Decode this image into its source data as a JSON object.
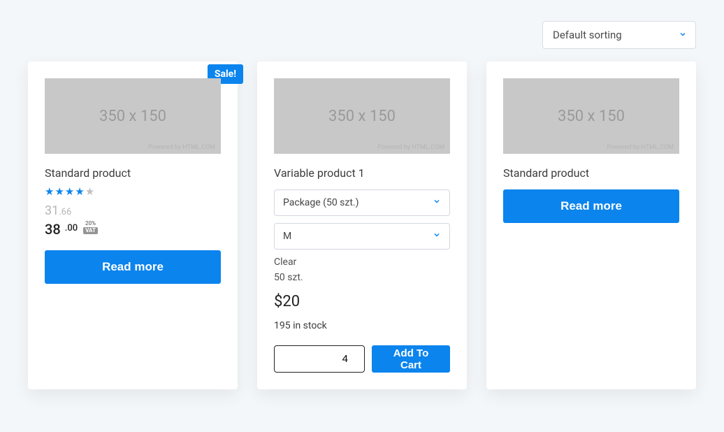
{
  "sort": {
    "selected": "Default sorting"
  },
  "products": [
    {
      "sale_label": "Sale!",
      "placeholder_text": "350 x 150",
      "placeholder_powered": "Powered by HTML.COM",
      "title": "Standard product",
      "rating": 4,
      "old_price_int": "31",
      "old_price_cents": ".66",
      "new_price_int": "38",
      "new_price_cents": ".00",
      "vat_percent": "20%",
      "vat_label": "VAT",
      "button": "Read more"
    },
    {
      "placeholder_text": "350 x 150",
      "placeholder_powered": "Powered by HTML.COM",
      "title": "Variable product 1",
      "option1": "Package (50 szt.)",
      "option2": "M",
      "clear_label": "Clear",
      "pack_label": "50 szt.",
      "price": "$20",
      "stock": "195 in stock",
      "qty": "4",
      "cart_button": "Add To Cart"
    },
    {
      "placeholder_text": "350 x 150",
      "placeholder_powered": "Powered by HTML.COM",
      "title": "Standard product",
      "button": "Read more"
    }
  ]
}
